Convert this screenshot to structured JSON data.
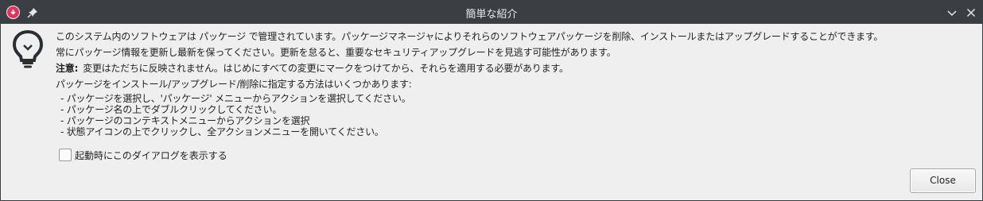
{
  "window": {
    "title": "簡単な紹介"
  },
  "icons": {
    "app": "download-arrow-icon",
    "pin": "pin-icon",
    "minimize": "chevron-down-icon",
    "close": "close-icon",
    "info": "lightbulb-icon"
  },
  "content": {
    "line1": "このシステム内のソフトウェアは パッケージ で管理されています。パッケージマネージャによりそれらのソフトウェアパッケージを削除、インストールまたはアップグレードすることができます。",
    "line2": "常にパッケージ情報を更新し最新を保ってください。更新を怠ると、重要なセキュリティアップグレードを見逃す可能性があります。",
    "note_label": "注意:",
    "note_text": "変更はただちに反映されません。はじめにすべての変更にマークをつけてから、それらを適用する必要があります。",
    "methods_intro": "パッケージをインストール/アップグレード/削除に指定する方法はいくつかあります:",
    "methods": [
      "- パッケージを選択し、'パッケージ' メニューからアクションを選択してください。",
      "- パッケージ名の上でダブルクリックしてください。",
      "- パッケージのコンテキストメニューからアクションを選択",
      "- 状態アイコンの上でクリックし、全アクションメニューを開いてください。"
    ]
  },
  "startup_checkbox": {
    "label": "起動時にこのダイアログを表示する",
    "checked": false
  },
  "buttons": {
    "close": "Close"
  },
  "colors": {
    "titlebar": "#3b3f44",
    "app_icon": "#e0345c",
    "background": "#efefef"
  }
}
